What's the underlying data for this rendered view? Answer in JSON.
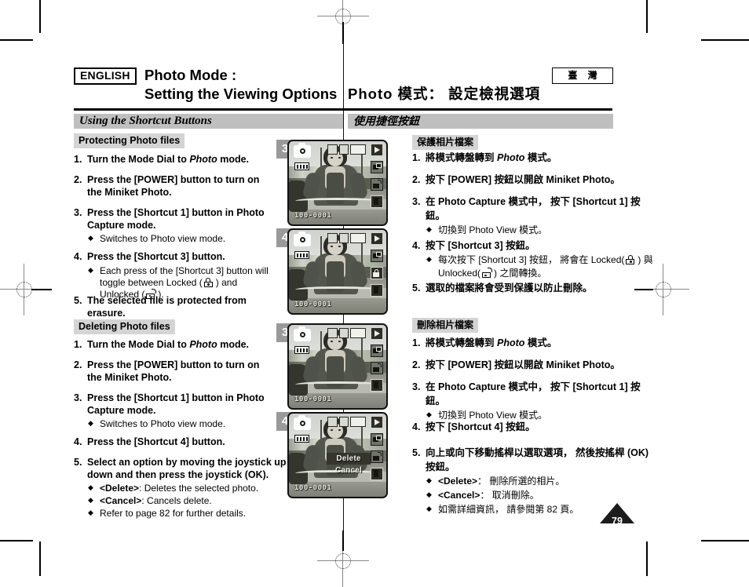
{
  "header": {
    "language_badge": "ENGLISH",
    "region_badge": "臺 灣",
    "title_en_line1": "Photo Mode :",
    "title_en_line2": "Setting the Viewing Options",
    "title_zh": "Photo 模式： 設定檢視選項"
  },
  "section_bar": {
    "en": "Using the Shortcut Buttons",
    "zh": "使用捷徑按鈕"
  },
  "protect": {
    "en": {
      "heading": "Protecting Photo files",
      "steps": [
        {
          "num": "1.",
          "text": "Turn the Mode Dial to ",
          "italic": "Photo",
          "tail": " mode."
        },
        {
          "num": "2.",
          "text": "Press the [POWER] button to turn on the Miniket Photo."
        },
        {
          "num": "3.",
          "text": "Press the [Shortcut 1] button in Photo Capture mode.",
          "bullets": [
            "Switches to Photo view mode."
          ]
        },
        {
          "num": "4.",
          "text": "Press the [Shortcut 3] button.",
          "bullet_lock_pre": "Each press of the [Shortcut 3] button will toggle between Locked (",
          "bullet_lock_mid": ") and Unlocked (",
          "bullet_lock_post": ")."
        },
        {
          "num": "5.",
          "text": "The selected file is protected from erasure."
        }
      ]
    },
    "zh": {
      "heading": "保護相片檔案",
      "steps": [
        {
          "num": "1.",
          "text": "將模式轉盤轉到 ",
          "italic": "Photo",
          "tail": " 模式。"
        },
        {
          "num": "2.",
          "text": "按下 [POWER] 按鈕以開啟 Miniket Photo。"
        },
        {
          "num": "3.",
          "text": "在 Photo Capture 模式中， 按下 [Shortcut 1] 按鈕。",
          "bullets": [
            "切換到 Photo View 模式。"
          ]
        },
        {
          "num": "4.",
          "text": "按下 [Shortcut 3] 按鈕。",
          "bullet_lock_pre": "每次按下 [Shortcut 3] 按鈕， 將會在 Locked(",
          "bullet_lock_mid": ") 與 Unlocked(",
          "bullet_lock_post": ") 之間轉換。"
        },
        {
          "num": "5.",
          "text": "選取的檔案將會受到保護以防止刪除。"
        }
      ]
    }
  },
  "delete": {
    "en": {
      "heading": "Deleting Photo files",
      "steps": [
        {
          "num": "1.",
          "text": "Turn the Mode Dial to ",
          "italic": "Photo",
          "tail": " mode."
        },
        {
          "num": "2.",
          "text": "Press the [POWER] button to turn on the Miniket Photo."
        },
        {
          "num": "3.",
          "text": "Press the [Shortcut 1] button in Photo Capture mode.",
          "bullets": [
            "Switches to Photo view mode."
          ]
        },
        {
          "num": "4.",
          "text": "Press the [Shortcut 4] button."
        },
        {
          "num": "5.",
          "text": "Select an option by moving the joystick up / down and then press the joystick (OK).",
          "bullets_rich": [
            {
              "bold": "<Delete>",
              "rest": ": Deletes the selected photo."
            },
            {
              "bold": "<Cancel>",
              "rest": ": Cancels delete."
            },
            {
              "bold": "",
              "rest": "Refer to page 82 for further details."
            }
          ]
        }
      ]
    },
    "zh": {
      "heading": "刪除相片檔案",
      "steps": [
        {
          "num": "1.",
          "text": "將模式轉盤轉到 ",
          "italic": "Photo",
          "tail": " 模式。"
        },
        {
          "num": "2.",
          "text": "按下 [POWER] 按鈕以開啟 Miniket Photo。"
        },
        {
          "num": "3.",
          "text": "在 Photo Capture 模式中， 按下 [Shortcut 1] 按鈕。",
          "bullets": [
            "切換到 Photo View 模式。"
          ]
        },
        {
          "num": "4.",
          "text": "按下 [Shortcut 4] 按鈕。"
        },
        {
          "num": "5.",
          "text": "向上或向下移動搖桿以選取選項， 然後按搖桿 (OK) 按鈕。",
          "bullets_rich": [
            {
              "bold": "<Delete>",
              "rest": "： 刪除所選的相片。"
            },
            {
              "bold": "<Cancel>",
              "rest": "： 取消刪除。"
            },
            {
              "bold": "",
              "rest": "如需詳細資訊， 請參閱第 82 頁。"
            }
          ]
        }
      ]
    }
  },
  "screenshots": [
    {
      "step": "3",
      "file_no": "100-0001",
      "lock_state": "unlocked",
      "menu": null
    },
    {
      "step": "4",
      "file_no": "100-0001",
      "lock_state": "locked",
      "menu": null
    },
    {
      "step": "3",
      "file_no": "100-0001",
      "lock_state": "unlocked",
      "menu": null
    },
    {
      "step": "4",
      "file_no": "100-0001",
      "lock_state": "unlocked",
      "menu": {
        "items": [
          "Delete",
          "Cancel"
        ],
        "selected": "Delete"
      }
    }
  ],
  "footer": {
    "page_number": "79"
  }
}
